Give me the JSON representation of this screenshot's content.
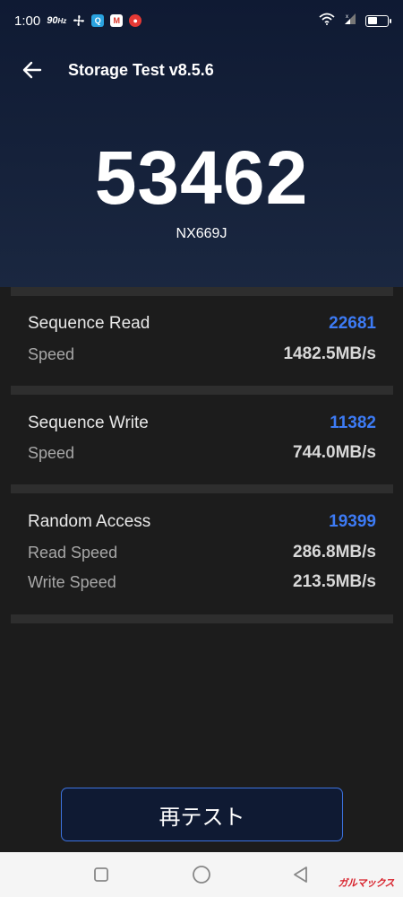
{
  "status_bar": {
    "time": "1:00",
    "refresh_rate": "90",
    "refresh_unit": "Hz",
    "icons": [
      "fan-icon",
      "q-app-icon",
      "gmail-icon",
      "tomato-app-icon",
      "wifi-icon",
      "signal-icon",
      "battery-icon"
    ]
  },
  "app_bar": {
    "back_icon": "arrow-left-icon",
    "title": "Storage Test v8.5.6"
  },
  "result": {
    "total_score": "53462",
    "device": "NX669J"
  },
  "sequence_read": {
    "title": "Sequence Read",
    "score": "22681",
    "speed_label": "Speed",
    "speed_value": "1482.5MB/s"
  },
  "sequence_write": {
    "title": "Sequence Write",
    "score": "11382",
    "speed_label": "Speed",
    "speed_value": "744.0MB/s"
  },
  "random_access": {
    "title": "Random Access",
    "score": "19399",
    "read_label": "Read Speed",
    "read_value": "286.8MB/s",
    "write_label": "Write Speed",
    "write_value": "213.5MB/s"
  },
  "actions": {
    "retest_label": "再テスト"
  },
  "nav_bar": {
    "icons": [
      "recent-apps-icon",
      "home-icon",
      "back-triangle-icon"
    ]
  },
  "watermark": {
    "text": "ガルマックス"
  },
  "colors": {
    "header_bg": "#0f1a33",
    "page_bg": "#1c1c1c",
    "score_accent": "#3d7bf5",
    "button_border": "#3d73e0"
  }
}
